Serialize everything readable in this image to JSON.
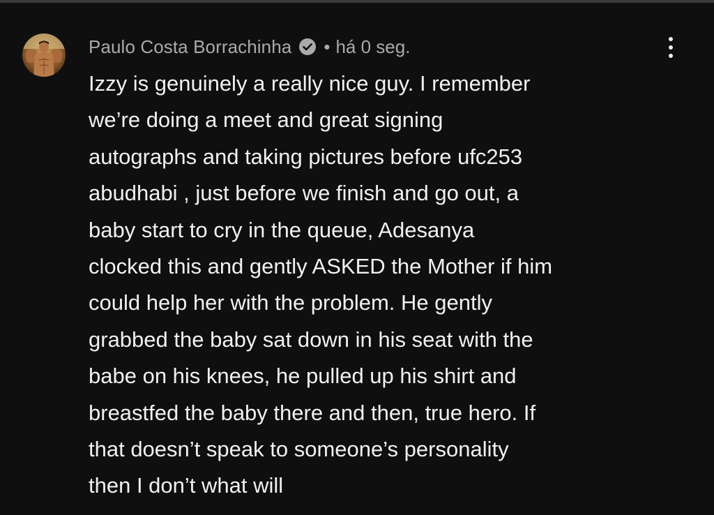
{
  "comment": {
    "author": "Paulo Costa Borrachinha",
    "verified": true,
    "separator": "•",
    "timestamp": "há 0 seg.",
    "menu_icon": "more-vertical-icon",
    "avatar_icon": "profile-photo-avatar",
    "verified_icon": "verified-check-icon",
    "lines": [
      "Izzy is genuinely a really nice guy. I remember",
      "we’re doing a meet and great signing",
      "autographs and taking pictures before ufc253",
      "abudhabi , just before we finish and go out, a",
      "baby start to cry in the queue, Adesanya",
      "clocked this and gently ASKED the Mother if him",
      "could help her with the problem. He gently",
      "grabbed the baby sat down in his seat with the",
      "babe on his knees, he pulled up his shirt and",
      "breastfed the baby there and then, true hero. If",
      "that doesn’t speak to someone’s personality",
      "then I don’t what will"
    ]
  },
  "colors": {
    "background": "#0f0f0f",
    "text_primary": "#f1f1f1",
    "text_secondary": "#aaaaaa"
  }
}
